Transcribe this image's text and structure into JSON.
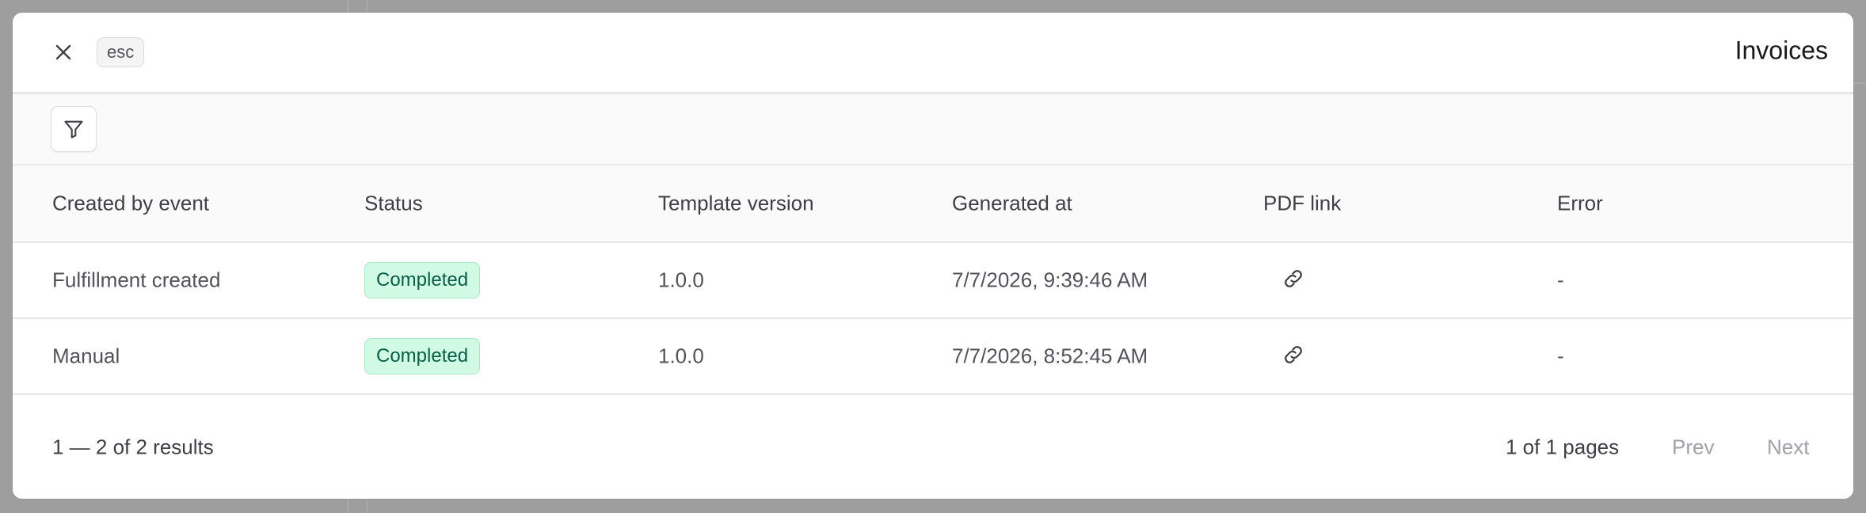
{
  "modal": {
    "title": "Invoices",
    "esc_label": "esc",
    "close_icon": "close-icon",
    "filter_icon": "filter-icon"
  },
  "table": {
    "headers": [
      "Created by event",
      "Status",
      "Template version",
      "Generated at",
      "PDF link",
      "Error"
    ],
    "rows": [
      {
        "created_by_event": "Fulfillment created",
        "status": "Completed",
        "template_version": "1.0.0",
        "generated_at": "7/7/2026, 9:39:46 AM",
        "pdf_link_icon": "link-icon",
        "error": "-"
      },
      {
        "created_by_event": "Manual",
        "status": "Completed",
        "template_version": "1.0.0",
        "generated_at": "7/7/2026, 8:52:45 AM",
        "pdf_link_icon": "link-icon",
        "error": "-"
      }
    ]
  },
  "pagination": {
    "results": "1 — 2 of 2 results",
    "pages": "1 of 1 pages",
    "prev_label": "Prev",
    "next_label": "Next"
  },
  "colors": {
    "status_completed_bg": "#d1fae5",
    "status_completed_text": "#065f46",
    "overlay": "#9e9e9e"
  }
}
